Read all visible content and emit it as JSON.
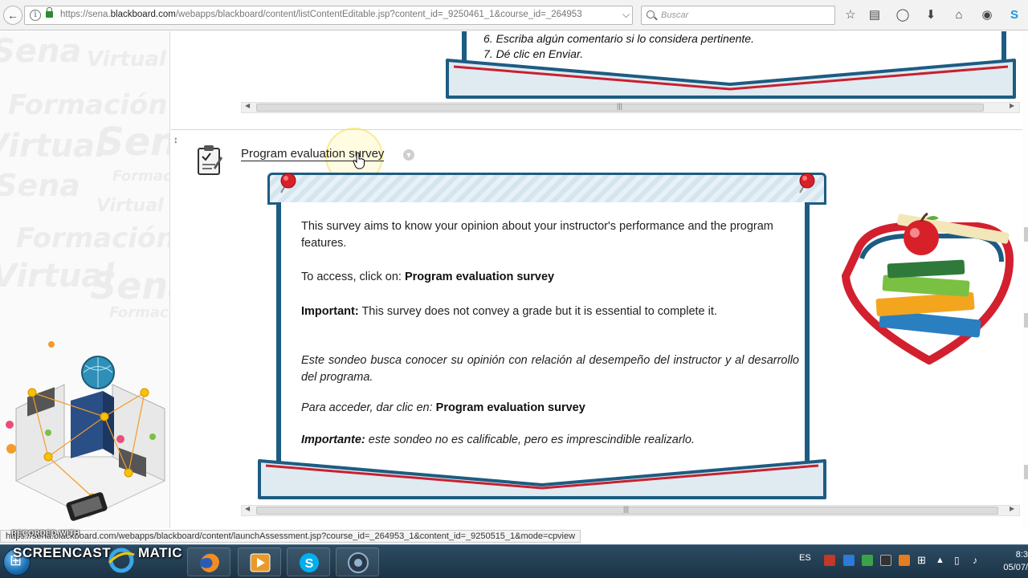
{
  "browser": {
    "url_prefix": "https://sena.",
    "url_domain": "blackboard.com",
    "url_rest": "/webapps/blackboard/content/listContentEditable.jsp?content_id=_9250461_1&course_id=_264953",
    "search_placeholder": "Buscar"
  },
  "previous_item": {
    "line6": "6. Escriba algún comentario si lo considera pertinente.",
    "line7": "7. Dé clic en Enviar."
  },
  "item": {
    "title": "Program evaluation survey",
    "en_intro": "This survey aims to know your opinion about your instructor's performance and the program features.",
    "en_access_prefix": "To access, click on: ",
    "en_access_link": "Program evaluation survey",
    "en_important_label": "Important:",
    "en_important_text": " This survey does not convey a grade but it is essential to complete it.",
    "es_intro": "Este sondeo busca conocer su opinión con relación al desempeño del instructor y al desarrollo del programa.",
    "es_access_prefix": "Para acceder, dar clic en: ",
    "es_access_link": "Program evaluation survey",
    "es_important_label": "Importante:",
    "es_important_text": " este sondeo no es calificable, pero es imprescindible realizarlo."
  },
  "watermark": {
    "words": [
      "Sena",
      "Virtual",
      "Formación",
      "Virtual",
      "Sena",
      "Formación",
      "Virtual",
      "Sena",
      "Formación",
      "Virtual",
      "Sena",
      "Formación"
    ]
  },
  "status": {
    "link_url": "https://sena.blackboard.com/webapps/blackboard/content/launchAssessment.jsp?course_id=_264953_1&content_id=_9250515_1&mode=cpview",
    "recorded_label": "RECORDED WITH"
  },
  "taskbar": {
    "brand_left": "SCREENCAST",
    "brand_right": "MATIC",
    "language": "ES",
    "time": "8:3",
    "date": "05/07/"
  },
  "colors": {
    "panel_border": "#1d5c82",
    "banner_red": "#c8202f"
  }
}
